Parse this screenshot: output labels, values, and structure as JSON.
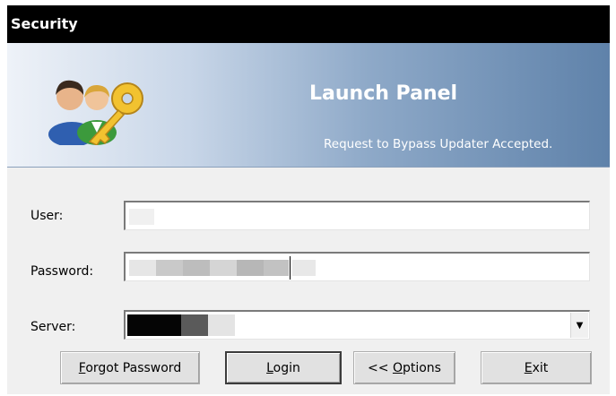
{
  "window": {
    "title": "Security"
  },
  "banner": {
    "heading": "Launch Panel",
    "status": "Request to Bypass Updater Accepted.",
    "logo_icon": "users-key-icon"
  },
  "form": {
    "user_label": "User:",
    "password_label": "Password:",
    "server_label": "Server:",
    "user_value": "",
    "password_value": "",
    "server_value": ""
  },
  "buttons": {
    "forgot_mnemonic": "F",
    "forgot_rest": "orgot Password",
    "login_mnemonic": "L",
    "login_rest": "ogin",
    "options_prefix": "<< ",
    "options_mnemonic": "O",
    "options_rest": "ptions",
    "exit_mnemonic": "E",
    "exit_rest": "xit"
  },
  "colors": {
    "titlebar": "#000000",
    "banner_gradient_start": "#eef2f8",
    "banner_gradient_end": "#5f82aa"
  }
}
